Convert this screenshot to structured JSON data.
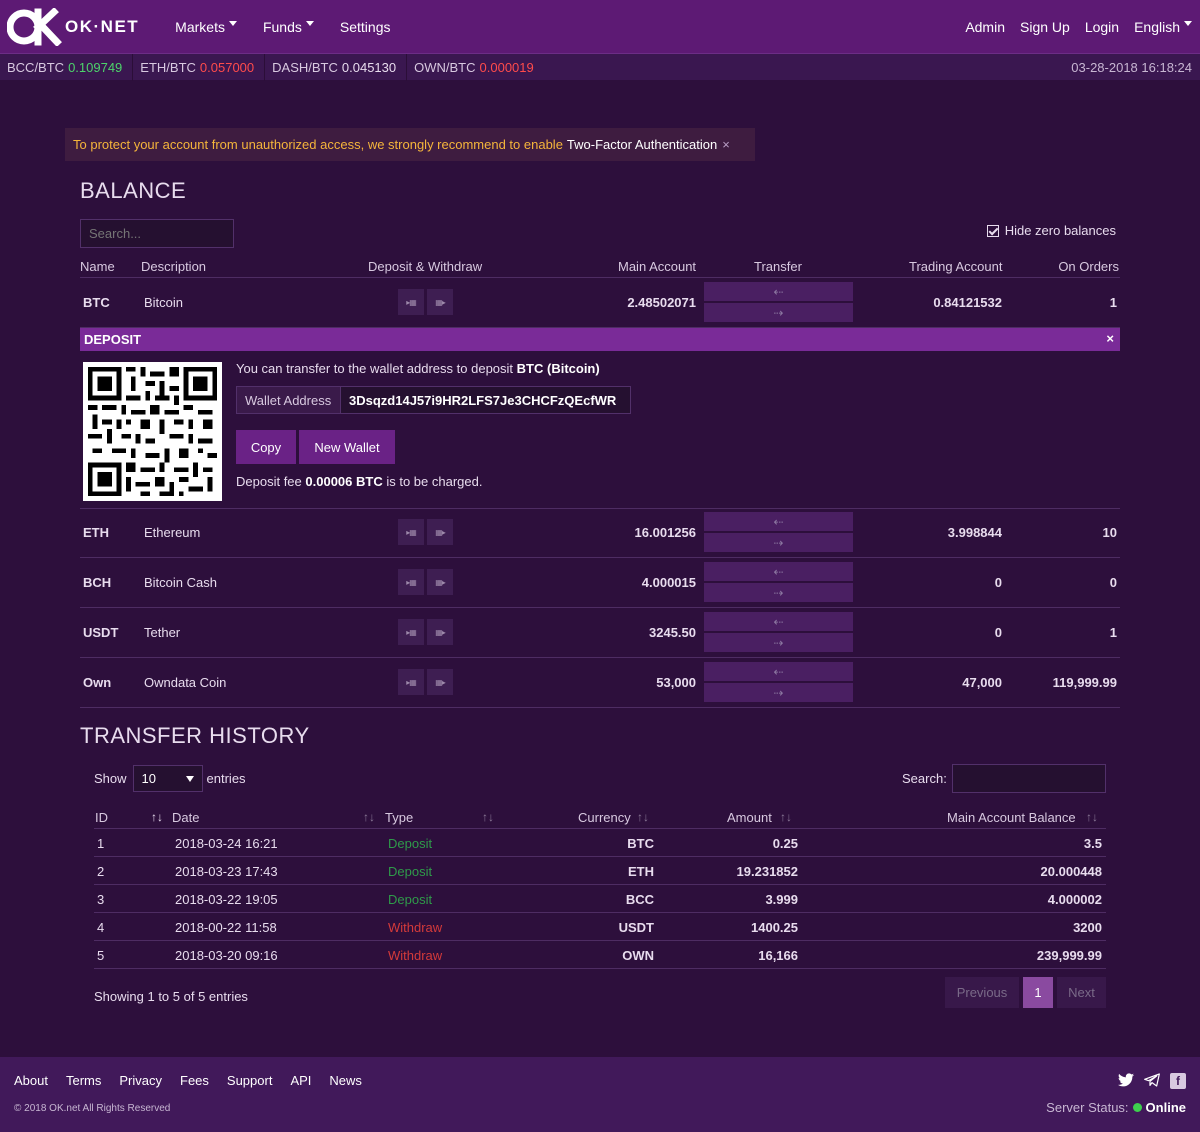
{
  "nav": {
    "logo_mark": "OK",
    "logo_text": "OK·NET",
    "menu": [
      "Markets",
      "Funds",
      "Settings"
    ],
    "right": [
      "Admin",
      "Sign Up",
      "Login",
      "English"
    ]
  },
  "ticker": {
    "items": [
      {
        "pair": "BCC/BTC",
        "value": "0.109749",
        "dir": "up"
      },
      {
        "pair": "ETH/BTC",
        "value": "0.057000",
        "dir": "down"
      },
      {
        "pair": "DASH/BTC",
        "value": "0.045130",
        "dir": "neutral"
      },
      {
        "pair": "OWN/BTC",
        "value": "0.000019",
        "dir": "down"
      }
    ],
    "time": "03-28-2018 16:18:24"
  },
  "alert": {
    "text": "To protect your account from unauthorized access, we strongly recommend to enable",
    "link": "Two-Factor Authentication",
    "close": "×"
  },
  "balance": {
    "title": "BALANCE",
    "search_placeholder": "Search...",
    "hide_zero": "Hide zero balances",
    "headers": {
      "name": "Name",
      "description": "Description",
      "deposit_withdraw": "Deposit & Withdraw",
      "main": "Main Account",
      "transfer": "Transfer",
      "trading": "Trading Account",
      "orders": "On Orders"
    },
    "rows": [
      {
        "sym": "BTC",
        "desc": "Bitcoin",
        "main": "2.48502071",
        "trade": "0.84121532",
        "orders": "1"
      },
      {
        "sym": "ETH",
        "desc": "Ethereum",
        "main": "16.001256",
        "trade": "3.998844",
        "orders": "10"
      },
      {
        "sym": "BCH",
        "desc": "Bitcoin Cash",
        "main": "4.000015",
        "trade": "0",
        "orders": "0"
      },
      {
        "sym": "USDT",
        "desc": "Tether",
        "main": "3245.50",
        "trade": "0",
        "orders": "1"
      },
      {
        "sym": "Own",
        "desc": "Owndata Coin",
        "main": "53,000",
        "trade": "47,000",
        "orders": "119,999.99"
      }
    ],
    "transfer_left": "⇠",
    "transfer_right": "⇢"
  },
  "deposit": {
    "title": "DEPOSIT",
    "close": "×",
    "text_prefix": "You can transfer to the wallet address to deposit",
    "text_coin": "BTC (Bitcoin)",
    "wallet_label": "Wallet Address",
    "wallet_value": "3Dsqzd14J57i9HR2LFS7Je3CHCFzQEcfWR",
    "copy_label": "Copy",
    "new_wallet_label": "New Wallet",
    "fee_prefix": "Deposit fee",
    "fee_value": "0.00006 BTC",
    "fee_suffix": "is to be charged."
  },
  "history": {
    "title": "TRANSFER HISTORY",
    "show_label": "Show",
    "show_value": "10",
    "entries_label": "entries",
    "search_label": "Search:",
    "headers": {
      "id": "ID",
      "date": "Date",
      "type": "Type",
      "currency": "Currency",
      "amount": "Amount",
      "balance": "Main Account Balance"
    },
    "rows": [
      {
        "id": "1",
        "date": "2018-03-24 16:21",
        "type": "Deposit",
        "currency": "BTC",
        "amount": "0.25",
        "balance": "3.5"
      },
      {
        "id": "2",
        "date": "2018-03-23 17:43",
        "type": "Deposit",
        "currency": "ETH",
        "amount": "19.231852",
        "balance": "20.000448"
      },
      {
        "id": "3",
        "date": "2018-03-22 19:05",
        "type": "Deposit",
        "currency": "BCC",
        "amount": "3.999",
        "balance": "4.000002"
      },
      {
        "id": "4",
        "date": "2018-00-22 11:58",
        "type": "Withdraw",
        "currency": "USDT",
        "amount": "1400.25",
        "balance": "3200"
      },
      {
        "id": "5",
        "date": "2018-03-20 09:16",
        "type": "Withdraw",
        "currency": "OWN",
        "amount": "16,166",
        "balance": "239,999.99"
      }
    ],
    "showing": "Showing 1 to 5 of 5 entries",
    "prev": "Previous",
    "page": "1",
    "next": "Next"
  },
  "footer": {
    "links": [
      "About",
      "Terms",
      "Privacy",
      "Fees",
      "Support",
      "API",
      "News"
    ],
    "copyright": "© 2018 OK.net All Rights Reserved",
    "status_label": "Server Status:",
    "status_value": "Online",
    "social_icons": [
      "twitter-icon",
      "telegram-icon",
      "facebook-icon"
    ]
  },
  "colors": {
    "accent": "#5d1a74",
    "bg": "#2d0f3c",
    "up": "#4dd36b",
    "down": "#ff4b4b",
    "online": "#3ecf4e"
  }
}
